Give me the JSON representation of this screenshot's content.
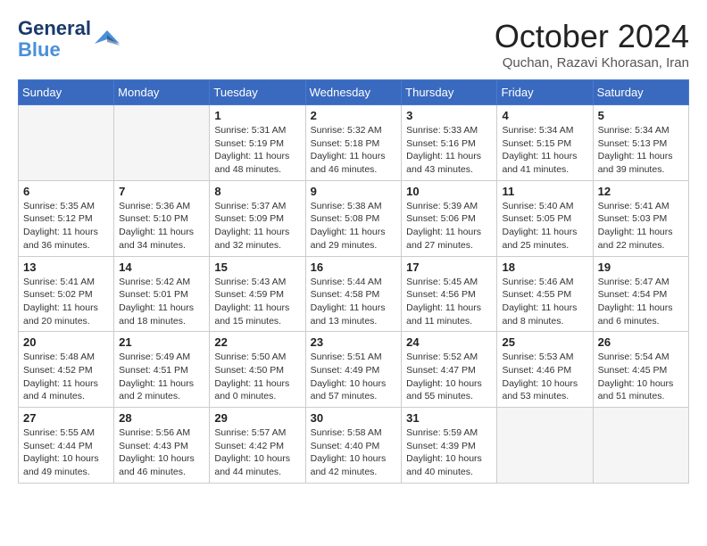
{
  "header": {
    "logo_line1": "General",
    "logo_line2": "Blue",
    "month_title": "October 2024",
    "subtitle": "Quchan, Razavi Khorasan, Iran"
  },
  "weekdays": [
    "Sunday",
    "Monday",
    "Tuesday",
    "Wednesday",
    "Thursday",
    "Friday",
    "Saturday"
  ],
  "weeks": [
    [
      {
        "day": "",
        "info": ""
      },
      {
        "day": "",
        "info": ""
      },
      {
        "day": "1",
        "info": "Sunrise: 5:31 AM\nSunset: 5:19 PM\nDaylight: 11 hours and 48 minutes."
      },
      {
        "day": "2",
        "info": "Sunrise: 5:32 AM\nSunset: 5:18 PM\nDaylight: 11 hours and 46 minutes."
      },
      {
        "day": "3",
        "info": "Sunrise: 5:33 AM\nSunset: 5:16 PM\nDaylight: 11 hours and 43 minutes."
      },
      {
        "day": "4",
        "info": "Sunrise: 5:34 AM\nSunset: 5:15 PM\nDaylight: 11 hours and 41 minutes."
      },
      {
        "day": "5",
        "info": "Sunrise: 5:34 AM\nSunset: 5:13 PM\nDaylight: 11 hours and 39 minutes."
      }
    ],
    [
      {
        "day": "6",
        "info": "Sunrise: 5:35 AM\nSunset: 5:12 PM\nDaylight: 11 hours and 36 minutes."
      },
      {
        "day": "7",
        "info": "Sunrise: 5:36 AM\nSunset: 5:10 PM\nDaylight: 11 hours and 34 minutes."
      },
      {
        "day": "8",
        "info": "Sunrise: 5:37 AM\nSunset: 5:09 PM\nDaylight: 11 hours and 32 minutes."
      },
      {
        "day": "9",
        "info": "Sunrise: 5:38 AM\nSunset: 5:08 PM\nDaylight: 11 hours and 29 minutes."
      },
      {
        "day": "10",
        "info": "Sunrise: 5:39 AM\nSunset: 5:06 PM\nDaylight: 11 hours and 27 minutes."
      },
      {
        "day": "11",
        "info": "Sunrise: 5:40 AM\nSunset: 5:05 PM\nDaylight: 11 hours and 25 minutes."
      },
      {
        "day": "12",
        "info": "Sunrise: 5:41 AM\nSunset: 5:03 PM\nDaylight: 11 hours and 22 minutes."
      }
    ],
    [
      {
        "day": "13",
        "info": "Sunrise: 5:41 AM\nSunset: 5:02 PM\nDaylight: 11 hours and 20 minutes."
      },
      {
        "day": "14",
        "info": "Sunrise: 5:42 AM\nSunset: 5:01 PM\nDaylight: 11 hours and 18 minutes."
      },
      {
        "day": "15",
        "info": "Sunrise: 5:43 AM\nSunset: 4:59 PM\nDaylight: 11 hours and 15 minutes."
      },
      {
        "day": "16",
        "info": "Sunrise: 5:44 AM\nSunset: 4:58 PM\nDaylight: 11 hours and 13 minutes."
      },
      {
        "day": "17",
        "info": "Sunrise: 5:45 AM\nSunset: 4:56 PM\nDaylight: 11 hours and 11 minutes."
      },
      {
        "day": "18",
        "info": "Sunrise: 5:46 AM\nSunset: 4:55 PM\nDaylight: 11 hours and 8 minutes."
      },
      {
        "day": "19",
        "info": "Sunrise: 5:47 AM\nSunset: 4:54 PM\nDaylight: 11 hours and 6 minutes."
      }
    ],
    [
      {
        "day": "20",
        "info": "Sunrise: 5:48 AM\nSunset: 4:52 PM\nDaylight: 11 hours and 4 minutes."
      },
      {
        "day": "21",
        "info": "Sunrise: 5:49 AM\nSunset: 4:51 PM\nDaylight: 11 hours and 2 minutes."
      },
      {
        "day": "22",
        "info": "Sunrise: 5:50 AM\nSunset: 4:50 PM\nDaylight: 11 hours and 0 minutes."
      },
      {
        "day": "23",
        "info": "Sunrise: 5:51 AM\nSunset: 4:49 PM\nDaylight: 10 hours and 57 minutes."
      },
      {
        "day": "24",
        "info": "Sunrise: 5:52 AM\nSunset: 4:47 PM\nDaylight: 10 hours and 55 minutes."
      },
      {
        "day": "25",
        "info": "Sunrise: 5:53 AM\nSunset: 4:46 PM\nDaylight: 10 hours and 53 minutes."
      },
      {
        "day": "26",
        "info": "Sunrise: 5:54 AM\nSunset: 4:45 PM\nDaylight: 10 hours and 51 minutes."
      }
    ],
    [
      {
        "day": "27",
        "info": "Sunrise: 5:55 AM\nSunset: 4:44 PM\nDaylight: 10 hours and 49 minutes."
      },
      {
        "day": "28",
        "info": "Sunrise: 5:56 AM\nSunset: 4:43 PM\nDaylight: 10 hours and 46 minutes."
      },
      {
        "day": "29",
        "info": "Sunrise: 5:57 AM\nSunset: 4:42 PM\nDaylight: 10 hours and 44 minutes."
      },
      {
        "day": "30",
        "info": "Sunrise: 5:58 AM\nSunset: 4:40 PM\nDaylight: 10 hours and 42 minutes."
      },
      {
        "day": "31",
        "info": "Sunrise: 5:59 AM\nSunset: 4:39 PM\nDaylight: 10 hours and 40 minutes."
      },
      {
        "day": "",
        "info": ""
      },
      {
        "day": "",
        "info": ""
      }
    ]
  ]
}
